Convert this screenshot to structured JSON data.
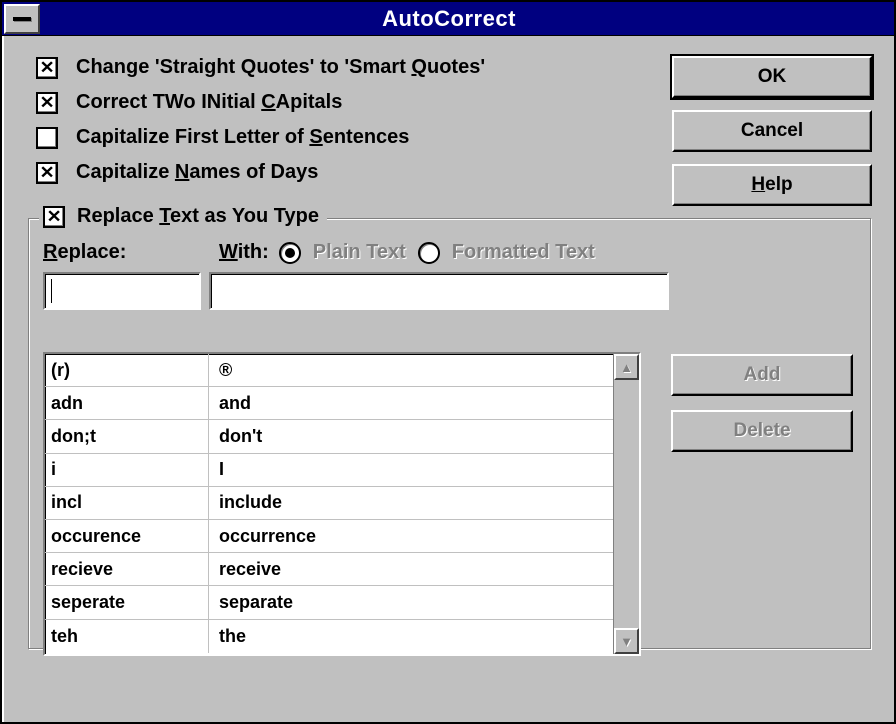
{
  "title": "AutoCorrect",
  "checkboxes": {
    "smart_quotes": {
      "checked": true,
      "label_pre": "Change 'Straight Quotes' to 'Smart ",
      "label_u": "Q",
      "label_post": "uotes'"
    },
    "two_initial": {
      "checked": true,
      "label_pre": "Correct TWo INitial ",
      "label_u": "C",
      "label_post": "Apitals"
    },
    "cap_sentence": {
      "checked": false,
      "label_pre": "Capitalize First Letter of ",
      "label_u": "S",
      "label_post": "entences"
    },
    "cap_days": {
      "checked": true,
      "label_pre": "Capitalize ",
      "label_u": "N",
      "label_post": "ames of Days"
    }
  },
  "buttons": {
    "ok": "OK",
    "cancel": "Cancel",
    "help_u": "H",
    "help_rest": "elp",
    "add": "Add",
    "delete": "Delete"
  },
  "group": {
    "checked": true,
    "label_pre": "Replace ",
    "label_u": "T",
    "label_post": "ext as You Type"
  },
  "fields": {
    "replace_u": "R",
    "replace_rest": "eplace:",
    "with_u": "W",
    "with_rest": "ith:",
    "plain": "Plain Text",
    "formatted": "Formatted Text",
    "format_selected": "plain",
    "replace_value": "",
    "with_value": ""
  },
  "list": [
    {
      "a": "(r)",
      "b": "®"
    },
    {
      "a": "adn",
      "b": "and"
    },
    {
      "a": "don;t",
      "b": "don't"
    },
    {
      "a": "i",
      "b": "I"
    },
    {
      "a": "incl",
      "b": "include"
    },
    {
      "a": "occurence",
      "b": "occurrence"
    },
    {
      "a": "recieve",
      "b": "receive"
    },
    {
      "a": "seperate",
      "b": "separate"
    },
    {
      "a": "teh",
      "b": "the"
    }
  ]
}
